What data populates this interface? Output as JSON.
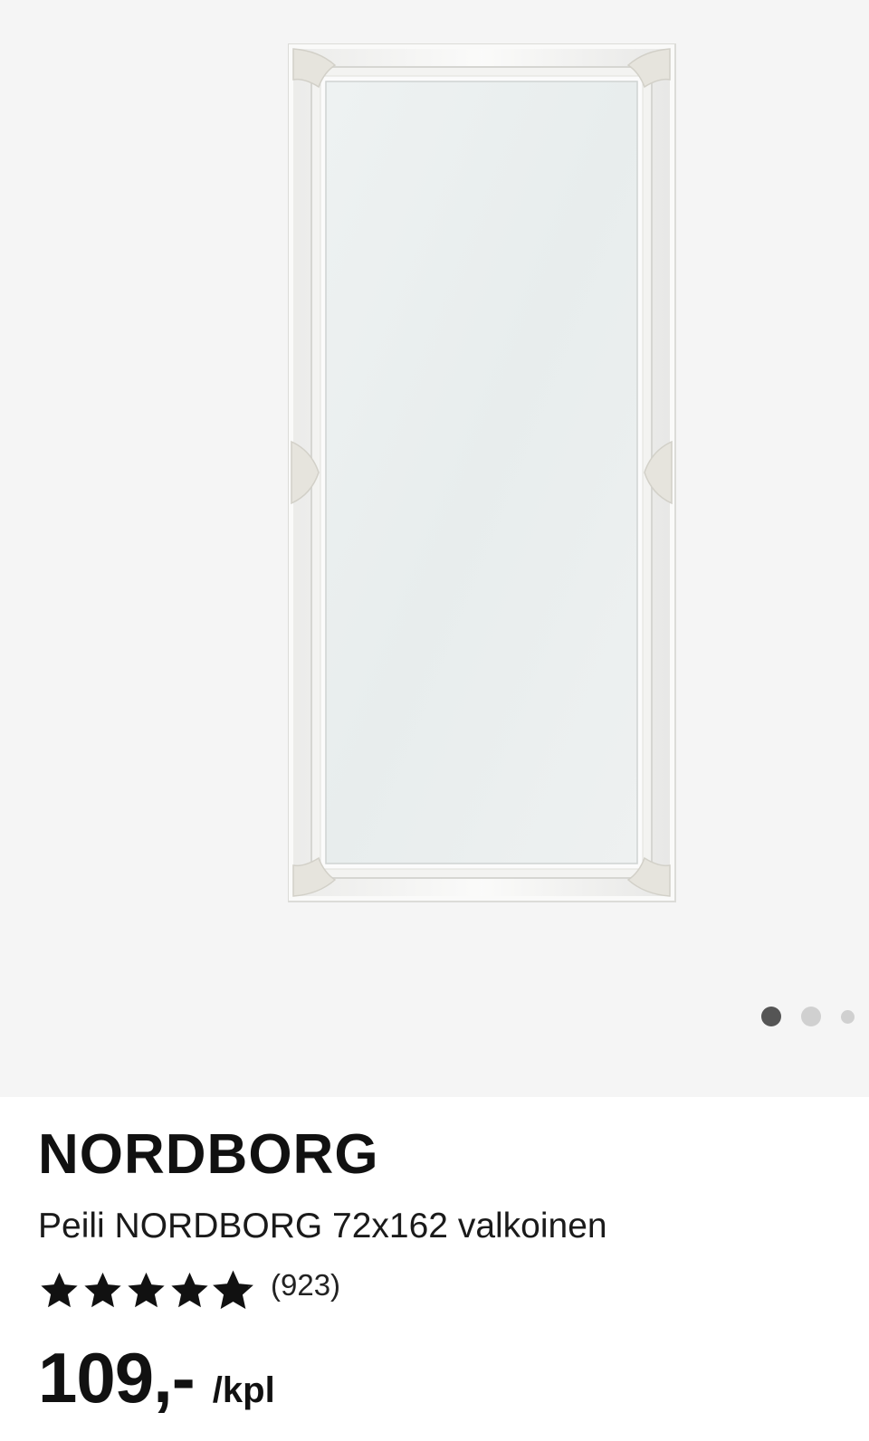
{
  "gallery": {
    "image_icon": "mirror-product-image",
    "page_count": 3,
    "active_page": 1
  },
  "product": {
    "name": "NORDBORG",
    "description": "Peili NORDBORG 72x162 valkoinen",
    "rating": {
      "stars_filled": 4.9,
      "stars_total": 5,
      "review_count": "(923)"
    },
    "price": "109,-",
    "unit": "/kpl"
  },
  "colors": {
    "gallery_bg": "#f5f5f5",
    "dot_active": "#555555",
    "dot_inactive": "#d0d0d0",
    "text": "#111111"
  }
}
